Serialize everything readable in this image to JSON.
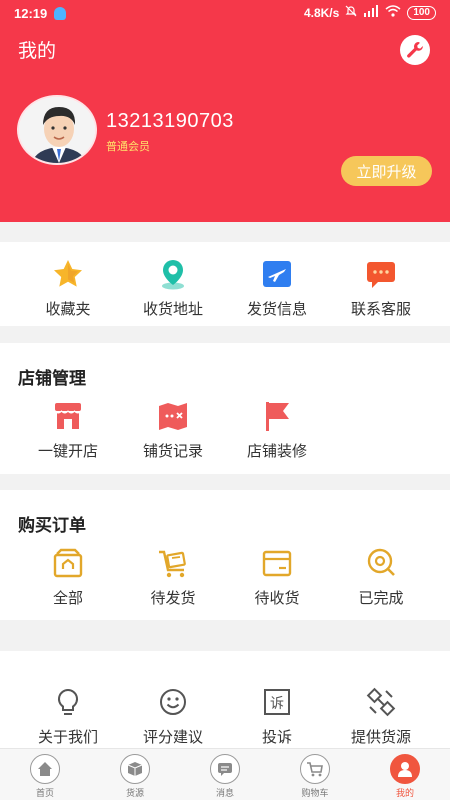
{
  "status_bar": {
    "time": "12:19",
    "network_speed": "4.8K/s",
    "battery": "100"
  },
  "header": {
    "title": "我的",
    "phone": "13213190703",
    "member_level": "普通会员",
    "upgrade_label": "立即升级"
  },
  "quick_links": [
    {
      "label": "收藏夹",
      "icon": "star-icon"
    },
    {
      "label": "收货地址",
      "icon": "location-icon"
    },
    {
      "label": "发货信息",
      "icon": "plane-icon"
    },
    {
      "label": "联系客服",
      "icon": "chat-icon"
    }
  ],
  "store": {
    "title": "店铺管理",
    "items": [
      {
        "label": "一键开店",
        "icon": "shop-icon"
      },
      {
        "label": "铺货记录",
        "icon": "map-icon"
      },
      {
        "label": "店铺装修",
        "icon": "flag-icon"
      }
    ]
  },
  "orders": {
    "title": "购买订单",
    "items": [
      {
        "label": "全部",
        "icon": "all-orders-icon"
      },
      {
        "label": "待发货",
        "icon": "cart-icon"
      },
      {
        "label": "待收货",
        "icon": "box-icon"
      },
      {
        "label": "已完成",
        "icon": "search-done-icon"
      }
    ]
  },
  "more": {
    "items": [
      {
        "label": "关于我们",
        "icon": "bulb-icon"
      },
      {
        "label": "评分建议",
        "icon": "smile-icon"
      },
      {
        "label": "投诉",
        "icon": "complaint-icon"
      },
      {
        "label": "提供货源",
        "icon": "source-icon"
      }
    ]
  },
  "tabbar": {
    "items": [
      {
        "label": "首页",
        "icon": "home-icon"
      },
      {
        "label": "货源",
        "icon": "goods-icon"
      },
      {
        "label": "消息",
        "icon": "message-icon"
      },
      {
        "label": "购物车",
        "icon": "cart-tab-icon"
      },
      {
        "label": "我的",
        "icon": "profile-icon"
      }
    ],
    "active_index": 4
  },
  "colors": {
    "brand_red": "#f5384a",
    "gold": "#f6c75a",
    "order_icon": "#e2a72a",
    "store_icon": "#ef5b5b"
  }
}
